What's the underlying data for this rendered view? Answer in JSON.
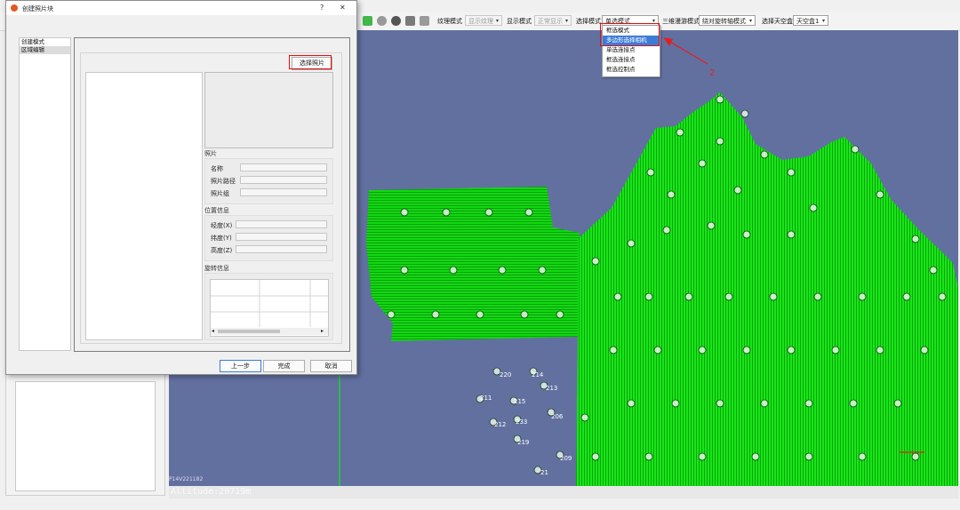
{
  "toolbar": {
    "texture_mode_label": "纹理模式",
    "texture_mode_value": "显示纹理",
    "display_mode_label": "显示模式",
    "display_mode_value": "正常显示",
    "select_mode_label": "选择模式",
    "select_mode_value": "单选模式",
    "nav_mode_label": "三维漫游模式",
    "nav_mode_value": "绕对旋转轴模式",
    "skybox_label": "选择天空盒",
    "skybox_value": "天空盒1"
  },
  "select_dropdown": {
    "options": [
      "框选模式",
      "多边形选择相机",
      "单选连接点",
      "框选连接点",
      "框选控制点"
    ],
    "selected_index": 1
  },
  "dialog": {
    "title": "创建照片块",
    "help_glyph": "?",
    "close_glyph": "✕",
    "nav_items": [
      "创建模式",
      "区域编辑"
    ],
    "choose_photo_button": "选择照片",
    "photo_group": {
      "title": "照片",
      "fields": [
        "名称",
        "照片路径",
        "照片组"
      ]
    },
    "position_group": {
      "title": "位置信息",
      "fields": [
        "经度(X)",
        "纬度(Y)",
        "高度(Z)"
      ]
    },
    "rotation_group": {
      "title": "旋转信息"
    },
    "buttons": {
      "back": "上一步",
      "finish": "完成",
      "cancel": "取消"
    }
  },
  "annotations": {
    "step1": "1",
    "step2": "2"
  },
  "viewport": {
    "altitude_text": "Altitude:20719m",
    "corner_label": "P14V221182",
    "point_labels": [
      "220",
      "214",
      "211",
      "215",
      "213",
      "212",
      "233",
      "206",
      "219",
      "209",
      "21"
    ]
  },
  "colors": {
    "viewport_bg": "#6270a0",
    "point_cloud": "#19e619",
    "highlight": "#e01010",
    "selection": "#3d7cd6"
  }
}
